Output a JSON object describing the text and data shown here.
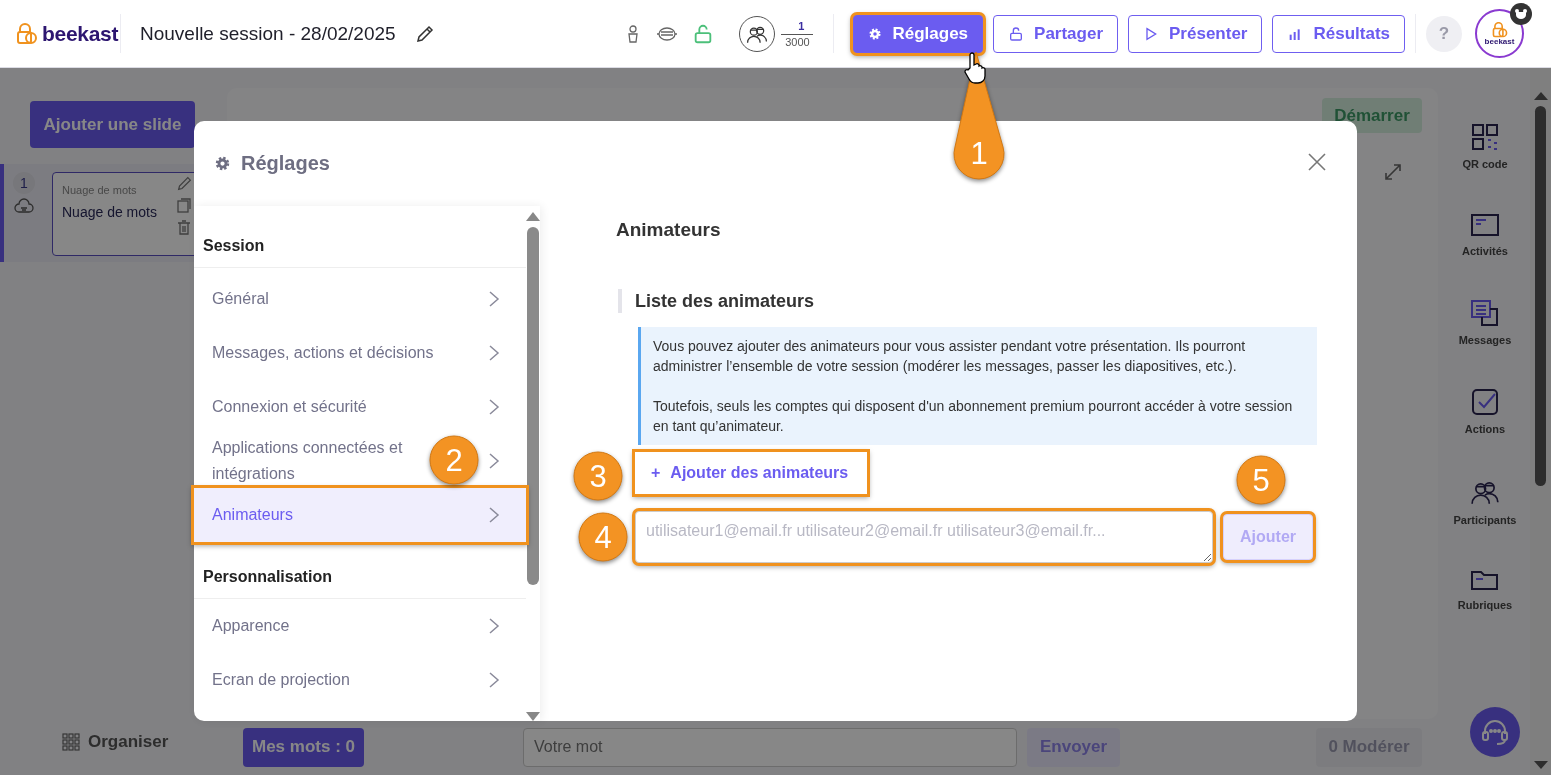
{
  "header": {
    "logo": "beekast",
    "title": "Nouvelle session - 28/02/2025",
    "participants": {
      "count": "1",
      "max": "3000"
    },
    "buttons": [
      {
        "label": "Réglages",
        "kind": "primary",
        "highlighted": true
      },
      {
        "label": "Partager",
        "kind": "outline",
        "highlighted": false
      },
      {
        "label": "Présenter",
        "kind": "outline",
        "highlighted": false
      },
      {
        "label": "Résultats",
        "kind": "outline",
        "highlighted": false
      }
    ],
    "help": "?",
    "avatar": "beekast"
  },
  "left_panel": {
    "add_button": "Ajouter une slide",
    "slides": [
      {
        "number": "1",
        "type": "Nuage de mots",
        "title": "Nuage de mots",
        "selected": true
      }
    ],
    "organise": "Organiser"
  },
  "stage": {
    "start_button": "Démarrer",
    "my_words_button": "Mes mots : 0",
    "word_field": {
      "placeholder": "Votre mot"
    },
    "send_button": "Envoyer",
    "moderate_button": "0 Modérer"
  },
  "right_sidebar": {
    "items": [
      {
        "label": "QR code"
      },
      {
        "label": "Activités"
      },
      {
        "label": "Messages"
      },
      {
        "label": "Actions"
      },
      {
        "label": "Participants"
      },
      {
        "label": "Rubriques"
      }
    ]
  },
  "modal": {
    "title": "Réglages",
    "nav": [
      {
        "heading": "Session",
        "items": [
          {
            "label": "Général",
            "selected": false,
            "highlighted": false
          },
          {
            "label": "Messages, actions et décisions",
            "selected": false,
            "highlighted": false
          },
          {
            "label": "Connexion et sécurité",
            "selected": false,
            "highlighted": false
          },
          {
            "label": "Applications connectées et intégrations",
            "selected": false,
            "highlighted": false
          },
          {
            "label": "Animateurs",
            "selected": true,
            "highlighted": true
          }
        ]
      },
      {
        "heading": "Personnalisation",
        "items": [
          {
            "label": "Apparence",
            "selected": false,
            "highlighted": false
          },
          {
            "label": "Ecran de projection",
            "selected": false,
            "highlighted": false
          }
        ]
      }
    ],
    "content": {
      "title": "Animateurs",
      "section": "Liste des animateurs",
      "info": [
        "Vous pouvez ajouter des animateurs pour vous assister pendant votre présentation. Ils pourront administrer l’ensemble de votre session (modérer les messages, passer les diapositives, etc.).",
        "Toutefois, seuls les comptes qui disposent d'un abonnement premium pourront accéder à votre session en tant qu’animateur."
      ],
      "add_link": {
        "icon": "+",
        "label": "Ajouter des animateurs",
        "highlighted": true
      },
      "emails_field": {
        "placeholder": "utilisateur1@email.fr utilisateur2@email.fr utilisateur3@email.fr...",
        "highlighted": true
      },
      "add_button": {
        "label": "Ajouter",
        "disabled": true,
        "highlighted": true
      }
    }
  },
  "annotations": [
    {
      "number": "1"
    },
    {
      "number": "2"
    },
    {
      "number": "3"
    },
    {
      "number": "4"
    },
    {
      "number": "5"
    }
  ]
}
